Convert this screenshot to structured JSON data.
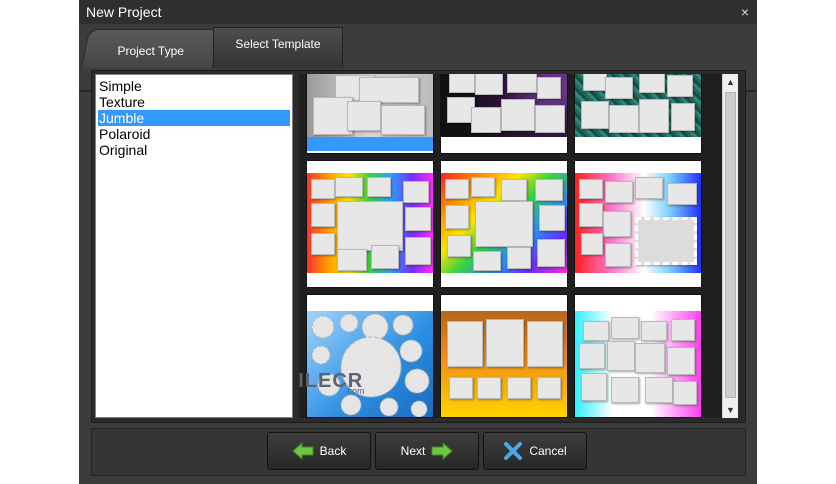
{
  "window": {
    "title": "New Project",
    "close_glyph": "×"
  },
  "tabs": [
    {
      "label": "Project Type"
    },
    {
      "label": "Select Template"
    }
  ],
  "template_types": {
    "items": [
      "Simple",
      "Texture",
      "Jumble",
      "Polaroid",
      "Original"
    ],
    "selected": "Jumble"
  },
  "templates": {
    "rows": 3,
    "columns": 3,
    "selected_index": 0,
    "items": [
      {
        "background": "silver-gradient",
        "icon": "jumble-template-thumbnail"
      },
      {
        "background": "dark-purple",
        "icon": "jumble-template-thumbnail"
      },
      {
        "background": "teal-texture",
        "icon": "jumble-template-thumbnail"
      },
      {
        "background": "rainbow-vertical",
        "icon": "jumble-template-thumbnail"
      },
      {
        "background": "rainbow-diagonal",
        "icon": "jumble-template-thumbnail"
      },
      {
        "background": "rainbow-stamp",
        "icon": "jumble-template-thumbnail"
      },
      {
        "background": "blue-sunbursts",
        "icon": "jumble-template-thumbnail"
      },
      {
        "background": "orange-yellow-gradient",
        "icon": "jumble-template-thumbnail"
      },
      {
        "background": "cyan-magenta-gradient",
        "icon": "jumble-template-thumbnail"
      }
    ]
  },
  "scrollbar": {
    "up_glyph": "▲",
    "down_glyph": "▼"
  },
  "buttons": {
    "back": {
      "label": "Back",
      "icon": "arrow-left-icon"
    },
    "next": {
      "label": "Next",
      "icon": "arrow-right-icon"
    },
    "cancel": {
      "label": "Cancel",
      "icon": "x-icon"
    }
  },
  "watermark": {
    "text": "FILECR",
    "suffix": ".com"
  },
  "colors": {
    "dialog_bg": "#3c3c3c",
    "selection": "#3399ff",
    "arrow_green": "#6cc644",
    "cancel_blue": "#4aa8e8"
  }
}
